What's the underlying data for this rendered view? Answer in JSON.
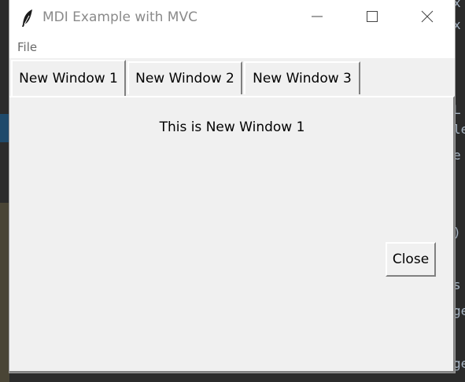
{
  "window": {
    "title": "MDI Example with MVC"
  },
  "menu": {
    "items": [
      "File"
    ]
  },
  "tabs": [
    {
      "label": "New Window 1",
      "selected": true
    },
    {
      "label": "New Window 2",
      "selected": false
    },
    {
      "label": "New Window 3",
      "selected": false
    }
  ],
  "content": {
    "label": "This is New Window 1",
    "close_button": "Close"
  },
  "background_code": [
    "x",
    "x",
    "L",
    "le",
    "e",
    ")",
    "s",
    "ge",
    "ge"
  ],
  "icons": {
    "app": "feather-icon",
    "minimize": "minimize-icon",
    "maximize": "maximize-icon",
    "close": "close-icon"
  }
}
